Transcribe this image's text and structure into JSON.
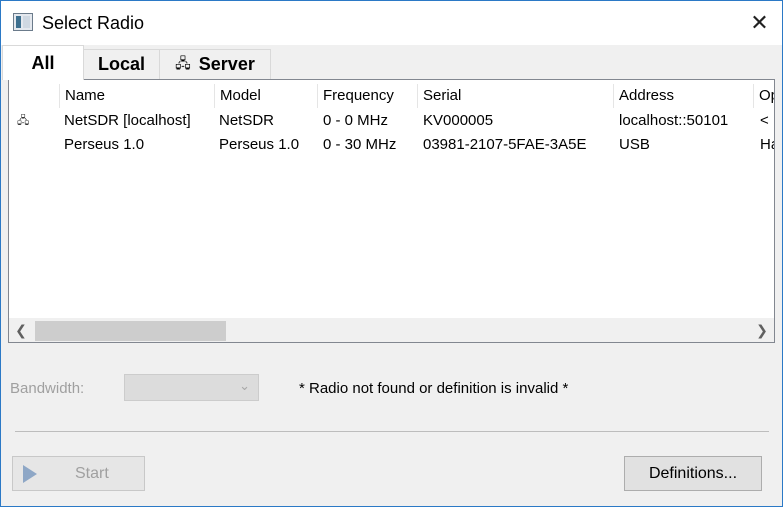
{
  "window": {
    "title": "Select Radio",
    "close_glyph": "✕",
    "accent": "#2b79c6"
  },
  "tabs": [
    {
      "label": "All",
      "icon": "",
      "active": true
    },
    {
      "label": "Local",
      "icon": "",
      "active": false
    },
    {
      "label": "Server",
      "icon": "network-icon",
      "glyph": "🖧",
      "active": false
    }
  ],
  "table": {
    "columns": [
      "Name",
      "Model",
      "Frequency",
      "Serial",
      "Address",
      "Op"
    ],
    "rows": [
      {
        "icon": "network-icon",
        "icon_glyph": "🖧",
        "name": "NetSDR [localhost]",
        "model": "NetSDR",
        "frequency": "0 - 0 MHz",
        "serial": "KV000005",
        "address": "localhost::50101",
        "extra": "<"
      },
      {
        "icon": "",
        "icon_glyph": "",
        "name": "Perseus 1.0",
        "model": "Perseus 1.0",
        "frequency": "0 - 30 MHz",
        "serial": "03981-2107-5FAE-3A5E",
        "address": "USB",
        "extra": "Ha"
      }
    ],
    "scroll_left": "❮",
    "scroll_right": "❯"
  },
  "bandwidth": {
    "label": "Bandwidth:",
    "value": "",
    "chevron": "⌄"
  },
  "status": {
    "message": "* Radio not found or definition is invalid *"
  },
  "buttons": {
    "start": "Start",
    "definitions": "Definitions..."
  }
}
